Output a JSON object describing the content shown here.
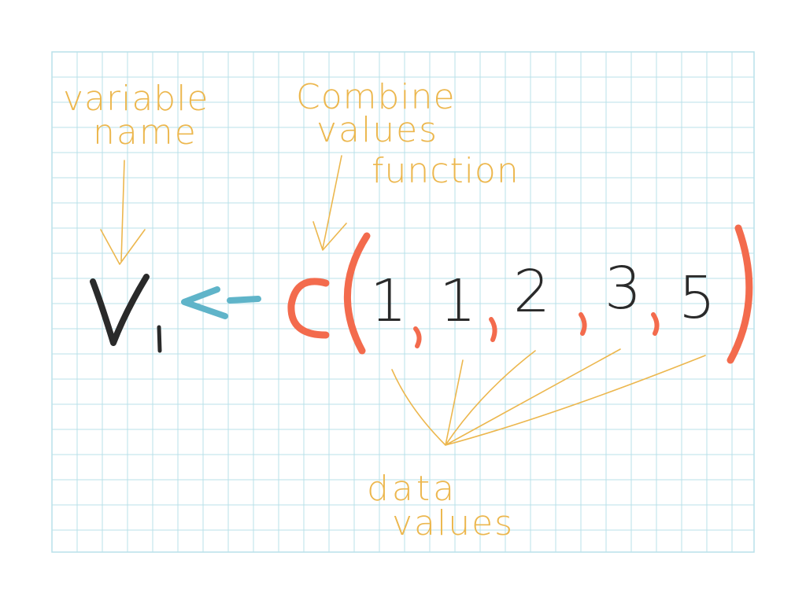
{
  "colors": {
    "grid": "#b9e1ea",
    "annotation": "#ecb74e",
    "ink_black": "#2a2a2a",
    "ink_blue": "#5fb4c9",
    "ink_red": "#f36b4d"
  },
  "annotations": {
    "variable_name": [
      "variable",
      "name"
    ],
    "combine_values_function": [
      "Combine",
      "values",
      "function"
    ],
    "data_values": [
      "data",
      "values"
    ]
  },
  "code": {
    "variable": "v",
    "variable_subscript": "1",
    "assign_operator": "<-",
    "function_name": "c",
    "open_paren": "(",
    "close_paren": ")",
    "separator": ",",
    "values": [
      "1",
      "1",
      "2",
      "3",
      "5"
    ]
  }
}
